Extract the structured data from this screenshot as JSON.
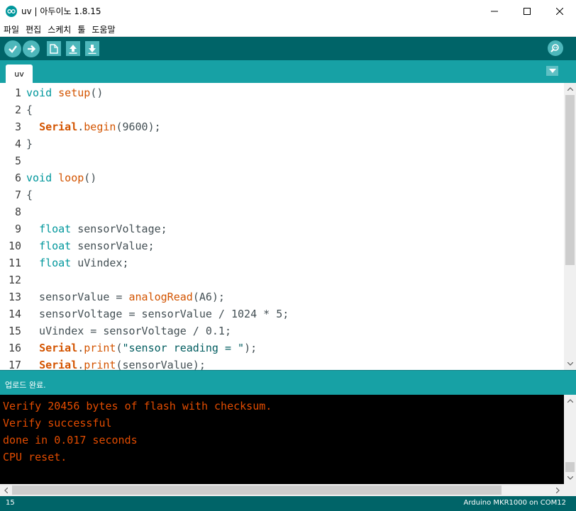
{
  "window": {
    "title": "uv | 아두이노 1.8.15",
    "controls": [
      "minimize-icon",
      "maximize-icon",
      "close-icon"
    ]
  },
  "menu": {
    "items": [
      "파일",
      "편집",
      "스케치",
      "툴",
      "도움말"
    ]
  },
  "toolbar": {
    "buttons": [
      "verify-icon",
      "upload-icon",
      "new-icon",
      "open-icon",
      "save-icon"
    ],
    "right_button": "serial-monitor-icon"
  },
  "tabs": {
    "active": "uv",
    "dropdown": "chevron-down-icon"
  },
  "editor": {
    "line_numbers": [
      "1",
      "2",
      "3",
      "4",
      "5",
      "6",
      "7",
      "8",
      "9",
      "10",
      "11",
      "12",
      "13",
      "14",
      "15",
      "16",
      "17"
    ],
    "lines": [
      "void setup()",
      "{",
      "  Serial.begin(9600);",
      "}",
      "",
      "void loop()",
      "{",
      "",
      "  float sensorVoltage;",
      "  float sensorValue;",
      "  float uVindex;",
      "",
      "  sensorValue = analogRead(A6);",
      "  sensorVoltage = sensorValue / 1024 * 5;",
      "  uVindex = sensorVoltage / 0.1;",
      "  Serial.print(\"sensor reading = \");",
      "  Serial.print(sensorValue);"
    ]
  },
  "status": {
    "message": "업로드 완료."
  },
  "console": {
    "lines": [
      "Verify 20456 bytes of flash with checksum.",
      "Verify successful",
      "done in 0.017 seconds",
      "CPU reset."
    ]
  },
  "footer": {
    "line": "15",
    "board": "Arduino MKR1000 on COM12"
  },
  "colors": {
    "toolbar": "#006468",
    "tabbar": "#17a1a5",
    "keyword": "#00979c",
    "function": "#d35400",
    "console_text": "#e34c00"
  }
}
